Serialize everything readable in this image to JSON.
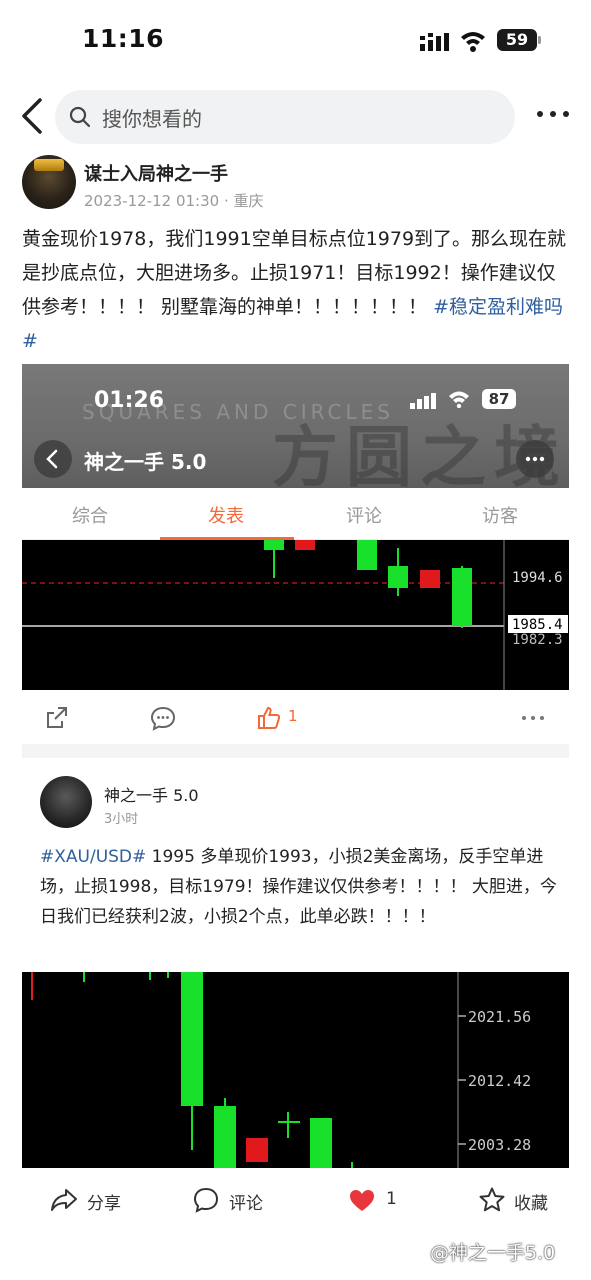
{
  "status_bar": {
    "time": "11:16",
    "battery": "59"
  },
  "nav": {
    "search_placeholder": "搜你想看的"
  },
  "author": {
    "name": "谋士入局神之一手",
    "date": "2023-12-12 01:30",
    "separator": "·",
    "location": "重庆"
  },
  "post": {
    "text": "黄金现价1978，我们1991空单目标点位1979到了。那么现在就是抄底点位，大胆进场多。止损1971！目标1992！操作建议仅供参考！！！！ 别墅靠海的神单！！！！！！！ ",
    "tag": "#稳定盈利难吗#"
  },
  "embedded": {
    "time": "01:26",
    "battery": "87",
    "watermark_en": "SQUARES AND CIRCLES",
    "watermark_cn": "方圆之境",
    "title": "神之一手 5.0",
    "tabs": [
      "综合",
      "发表",
      "评论",
      "访客"
    ],
    "active_tab": 1,
    "chart_labels": [
      "1994.6",
      "1985.4",
      "1982.3"
    ],
    "like_count": "1"
  },
  "repost": {
    "name": "神之一手 5.0",
    "time": "3小时",
    "tag": "#XAU/USD#",
    "text": " 1995 多单现价1993，小损2美金离场，反手空单进场，止损1998，目标1979！操作建议仅供参考！！！！ 大胆进，今日我们已经获利2波，小损2个点，此单必跌！！！！",
    "chart_labels": [
      "2021.56",
      "2012.42",
      "2003.28"
    ]
  },
  "bottom_bar": {
    "share": "分享",
    "comment": "评论",
    "like_count": "1",
    "favorite": "收藏"
  },
  "watermark": "@神之一手5.0",
  "colors": {
    "accent_orange": "#f2693a",
    "tag_blue": "#2f5f9e",
    "like_red": "#e8373c",
    "candle_green": "#19e02a",
    "candle_red": "#e01a1a"
  }
}
